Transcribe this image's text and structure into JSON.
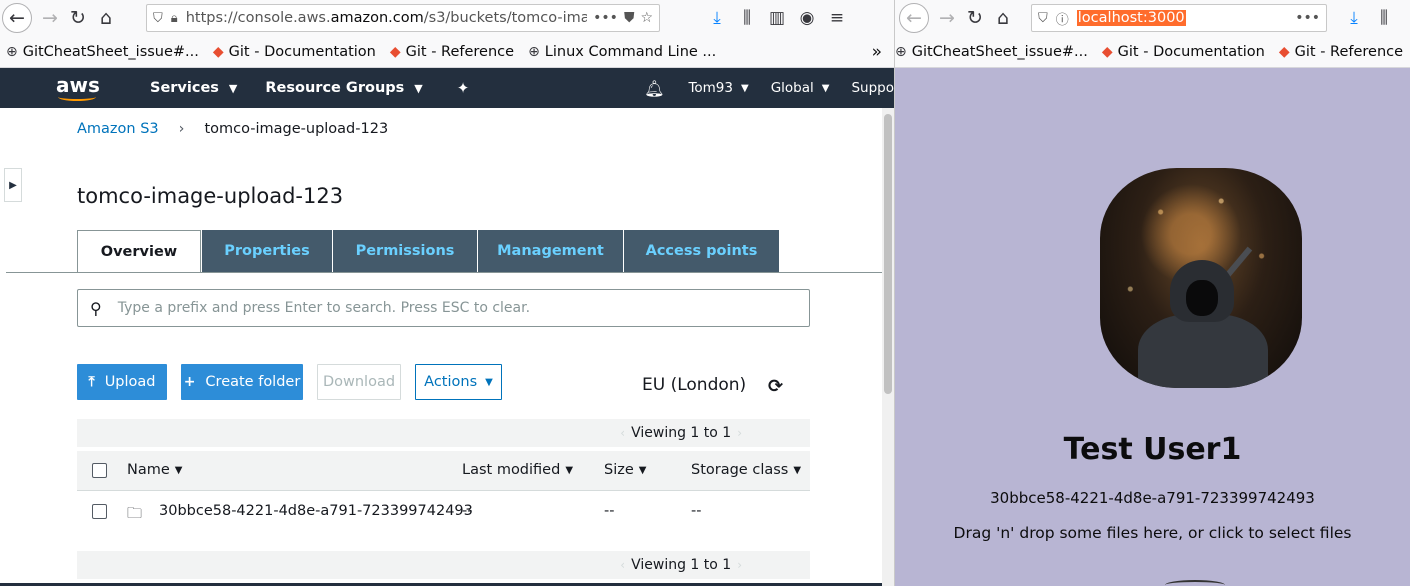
{
  "left_browser": {
    "url_prefix": "https://console.aws.",
    "url_domain": "amazon.com",
    "url_path": "/s3/buckets/tomco-ima",
    "url_more": "•••",
    "bookmarks": [
      {
        "label": "GitCheatSheet_issue#...",
        "icon": "globe-icon"
      },
      {
        "label": "Git - Documentation",
        "icon": "git-icon"
      },
      {
        "label": "Git - Reference",
        "icon": "git-icon"
      },
      {
        "label": "Linux Command Line ...",
        "icon": "globe-icon"
      }
    ],
    "overflow": "»"
  },
  "aws_header": {
    "logo": "aws",
    "services": "Services",
    "resource_groups": "Resource Groups",
    "user": "Tom93",
    "region": "Global",
    "support": "Suppo"
  },
  "s3": {
    "breadcrumb_root": "Amazon S3",
    "breadcrumb_sep": "›",
    "breadcrumb_current": "tomco-image-upload-123",
    "bucket_title": "tomco-image-upload-123",
    "tabs": [
      "Overview",
      "Properties",
      "Permissions",
      "Management",
      "Access points"
    ],
    "search_placeholder": "Type a prefix and press Enter to search. Press ESC to clear.",
    "buttons": {
      "upload": "Upload",
      "create_folder": "Create folder",
      "download": "Download",
      "actions": "Actions"
    },
    "region": "EU (London)",
    "viewing_top": "Viewing 1 to 1",
    "viewing_bottom": "Viewing 1 to 1",
    "columns": [
      "Name",
      "Last modified",
      "Size",
      "Storage class"
    ],
    "rows": [
      {
        "name": "30bbce58-4221-4d8e-a791-723399742493",
        "last_modified": "--",
        "size": "--",
        "storage_class": "--"
      }
    ]
  },
  "right_browser": {
    "url": "localhost:3000",
    "url_more": "•••",
    "bookmarks": [
      {
        "label": "GitCheatSheet_issue#...",
        "icon": "globe-icon"
      },
      {
        "label": "Git - Documentation",
        "icon": "git-icon"
      },
      {
        "label": "Git - Reference",
        "icon": "git-icon"
      }
    ]
  },
  "app": {
    "user_name": "Test User1",
    "user_id": "30bbce58-4221-4d8e-a791-723399742493",
    "dropzone_text": "Drag 'n' drop some files here, or click to select files",
    "background_color": "#b8b5d3"
  }
}
